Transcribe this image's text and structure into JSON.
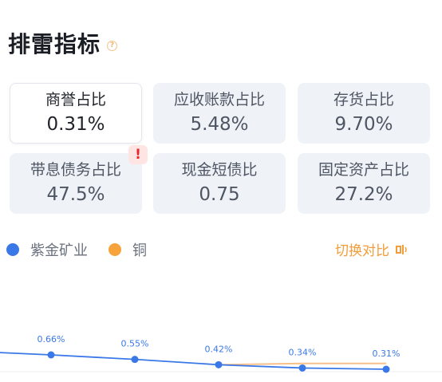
{
  "header": {
    "title": "排雷指标",
    "help_icon": "question-circle-icon"
  },
  "metrics": [
    {
      "label": "商誉占比",
      "value": "0.31%",
      "active": true,
      "alert": false
    },
    {
      "label": "应收账款占比",
      "value": "5.48%",
      "active": false,
      "alert": false
    },
    {
      "label": "存货占比",
      "value": "9.70%",
      "active": false,
      "alert": false
    },
    {
      "label": "带息债务占比",
      "value": "47.5%",
      "active": false,
      "alert": true
    },
    {
      "label": "现金短债比",
      "value": "0.75",
      "active": false,
      "alert": false
    },
    {
      "label": "固定资产占比",
      "value": "27.2%",
      "active": false,
      "alert": false
    }
  ],
  "alert_badge": "!",
  "legend": {
    "items": [
      {
        "name": "紫金矿业",
        "color": "#3a78e8"
      },
      {
        "name": "铜",
        "color": "#f7a23b"
      }
    ]
  },
  "switch": {
    "label": "切换对比",
    "icon": "speaker-toggle-icon"
  },
  "chart_data": {
    "type": "line",
    "categories": [
      "",
      "",
      "",
      "",
      "",
      ""
    ],
    "series": [
      {
        "name": "紫金矿业",
        "color": "#3a78e8",
        "values": [
          0.75,
          0.66,
          0.55,
          0.42,
          0.34,
          0.31
        ]
      },
      {
        "name": "铜",
        "color": "#f7c08a",
        "values": [
          null,
          null,
          null,
          0.42,
          0.45,
          0.45
        ]
      }
    ],
    "data_labels": [
      "",
      "0.66%",
      "0.55%",
      "0.42%",
      "0.34%",
      "0.31%"
    ],
    "title": "",
    "xlabel": "",
    "ylabel": ""
  }
}
